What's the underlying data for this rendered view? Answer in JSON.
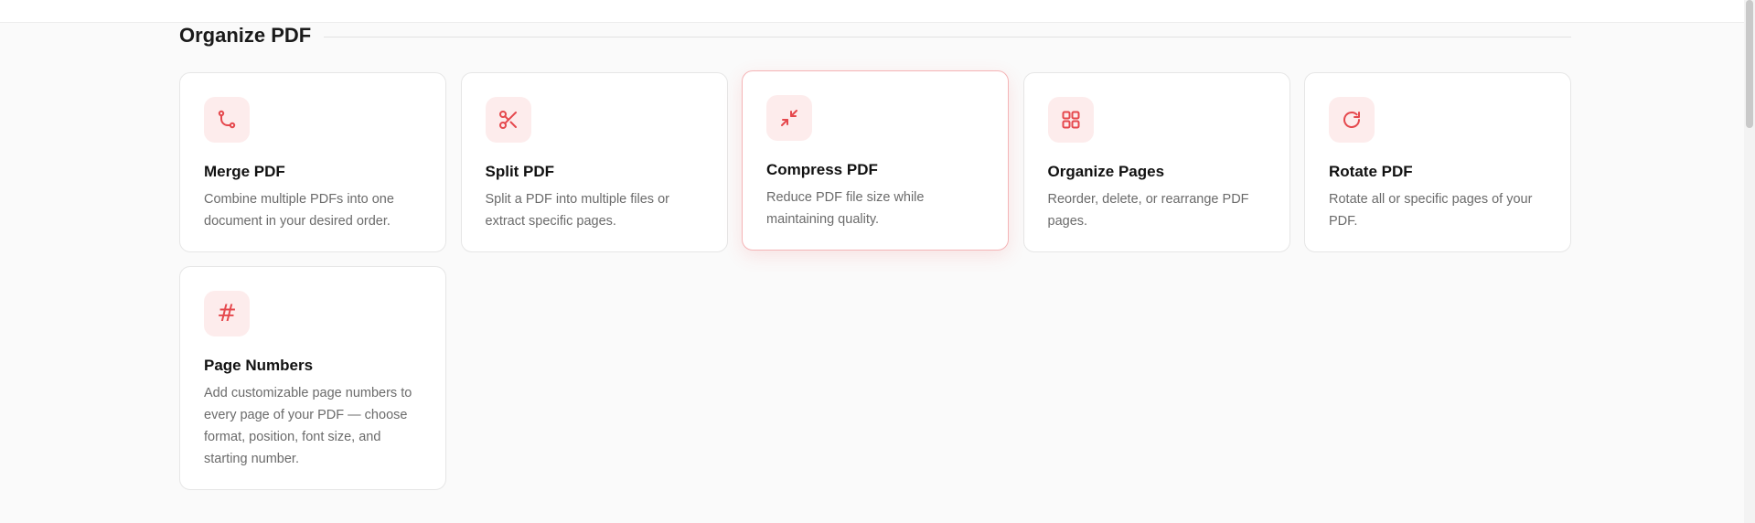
{
  "section": {
    "title": "Organize PDF"
  },
  "tools": [
    {
      "id": "merge",
      "icon": "merge-icon",
      "title": "Merge PDF",
      "description": "Combine multiple PDFs into one document in your desired order."
    },
    {
      "id": "split",
      "icon": "scissors-icon",
      "title": "Split PDF",
      "description": "Split a PDF into multiple files or extract specific pages."
    },
    {
      "id": "compress",
      "icon": "compress-icon",
      "title": "Compress PDF",
      "description": "Reduce PDF file size while maintaining quality."
    },
    {
      "id": "organize",
      "icon": "grid-icon",
      "title": "Organize Pages",
      "description": "Reorder, delete, or rearrange PDF pages."
    },
    {
      "id": "rotate",
      "icon": "rotate-icon",
      "title": "Rotate PDF",
      "description": "Rotate all or specific pages of your PDF."
    },
    {
      "id": "page-numbers",
      "icon": "hash-icon",
      "title": "Page Numbers",
      "description": "Add customizable page numbers to every page of your PDF — choose format, position, font size, and starting number."
    }
  ],
  "colors": {
    "accent": "#e5484d",
    "icon_bg": "#fdecec",
    "highlight_border": "#f5b4b6"
  }
}
